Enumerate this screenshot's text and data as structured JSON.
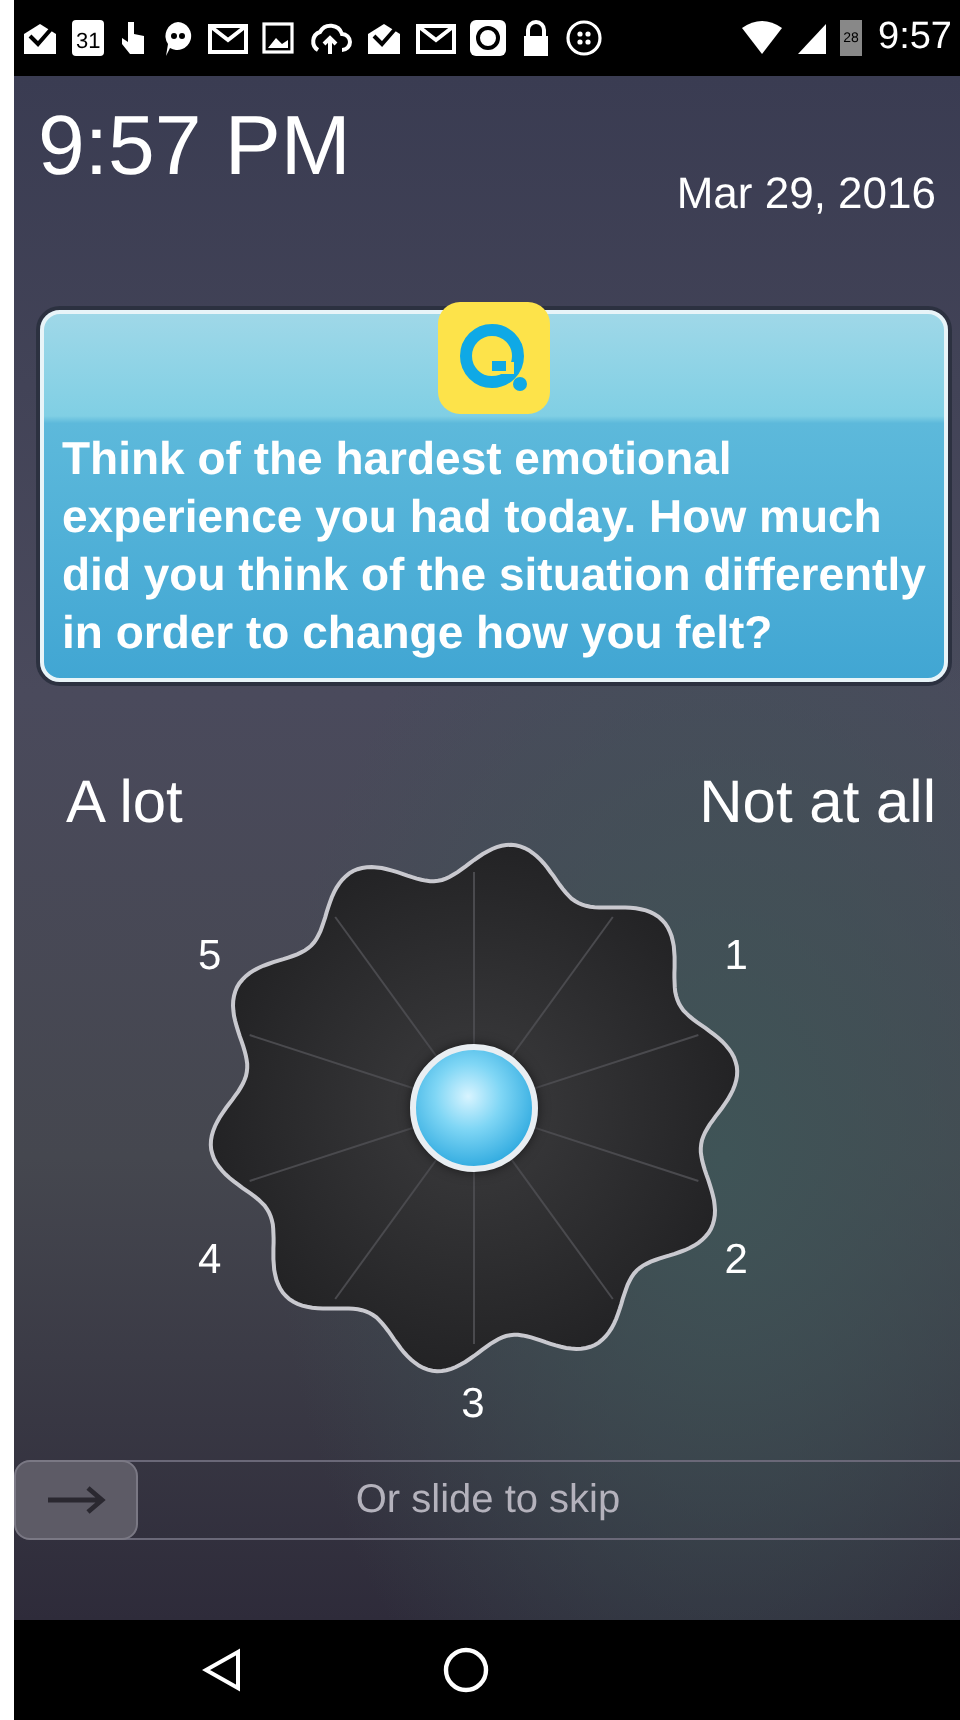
{
  "status_bar": {
    "calendar_date": "31",
    "battery_text": "28",
    "time": "9:57"
  },
  "header": {
    "time": "9:57 PM",
    "date": "Mar 29, 2016"
  },
  "question": {
    "text": "Think of the hardest emotional experience you had today. How much did you think of the situation differently in order to change how you felt?"
  },
  "scale": {
    "left_label": "A lot",
    "right_label": "Not at all",
    "points": [
      "1",
      "2",
      "3",
      "4",
      "5"
    ]
  },
  "skip": {
    "label": "Or slide to skip",
    "level": 0
  }
}
